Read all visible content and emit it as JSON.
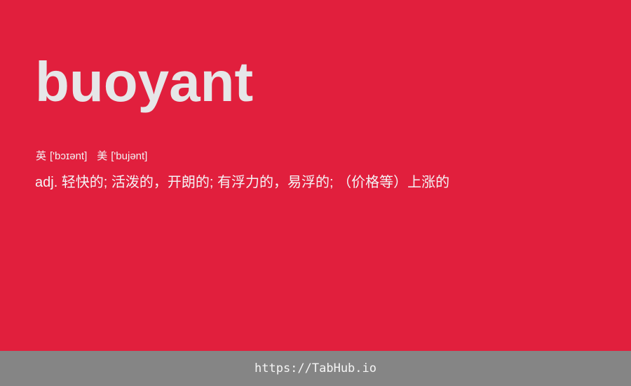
{
  "card": {
    "background": "#e11f3d",
    "word": "buoyant",
    "phonetics": {
      "uk_label": "英",
      "uk": "['bɔɪənt]",
      "us_label": "美",
      "us": "['bujənt]"
    },
    "definition": "adj. 轻快的; 活泼的，开朗的; 有浮力的，易浮的; （价格等）上涨的"
  },
  "footer": {
    "background": "#858585",
    "link": "https://TabHub.io"
  }
}
